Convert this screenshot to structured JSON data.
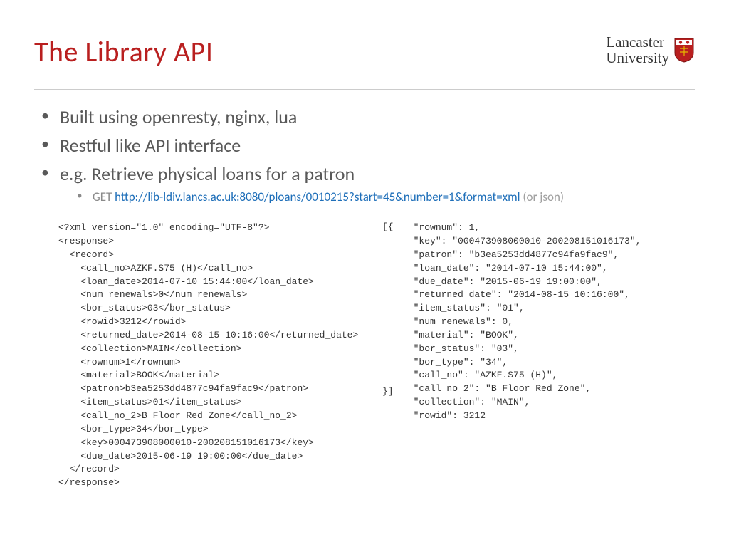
{
  "title": "The Library API",
  "logo": {
    "line1": "Lancaster",
    "line2": "University"
  },
  "bullets": {
    "b1": "Built using openresty, nginx, lua",
    "b2": "Restful like API interface",
    "b3": "e.g. Retrieve physical loans for a patron",
    "sub": {
      "get": "GET ",
      "url": "http://lib-ldiv.lancs.ac.uk:8080/ploans/0010215?start=45&number=1&format=xml",
      "suffix": " (or json)"
    }
  },
  "xml": "<?xml version=\"1.0\" encoding=\"UTF-8\"?>\n<response>\n  <record>\n    <call_no>AZKF.S75 (H)</call_no>\n    <loan_date>2014-07-10 15:44:00</loan_date>\n    <num_renewals>0</num_renewals>\n    <bor_status>03</bor_status>\n    <rowid>3212</rowid>\n    <returned_date>2014-08-15 10:16:00</returned_date>\n    <collection>MAIN</collection>\n    <rownum>1</rownum>\n    <material>BOOK</material>\n    <patron>b3ea5253dd4877c94fa9fac9</patron>\n    <item_status>01</item_status>\n    <call_no_2>B Floor Red Zone</call_no_2>\n    <bor_type>34</bor_type>\n    <key>000473908000010-200208151016173</key>\n    <due_date>2015-06-19 19:00:00</due_date>\n  </record>\n</response>",
  "json_open": "[{",
  "json_body": "\"rownum\": 1,\n\"key\": \"000473908000010-200208151016173\",\n\"patron\": \"b3ea5253dd4877c94fa9fac9\",\n\"loan_date\": \"2014-07-10 15:44:00\",\n\"due_date\": \"2015-06-19 19:00:00\",\n\"returned_date\": \"2014-08-15 10:16:00\",\n\"item_status\": \"01\",\n\"num_renewals\": 0,\n\"material\": \"BOOK\",\n\"bor_status\": \"03\",\n\"bor_type\": \"34\",\n\"call_no\": \"AZKF.S75 (H)\",\n\"call_no_2\": \"B Floor Red Zone\",\n\"collection\": \"MAIN\",\n\"rowid\": 3212",
  "json_close": "}]"
}
